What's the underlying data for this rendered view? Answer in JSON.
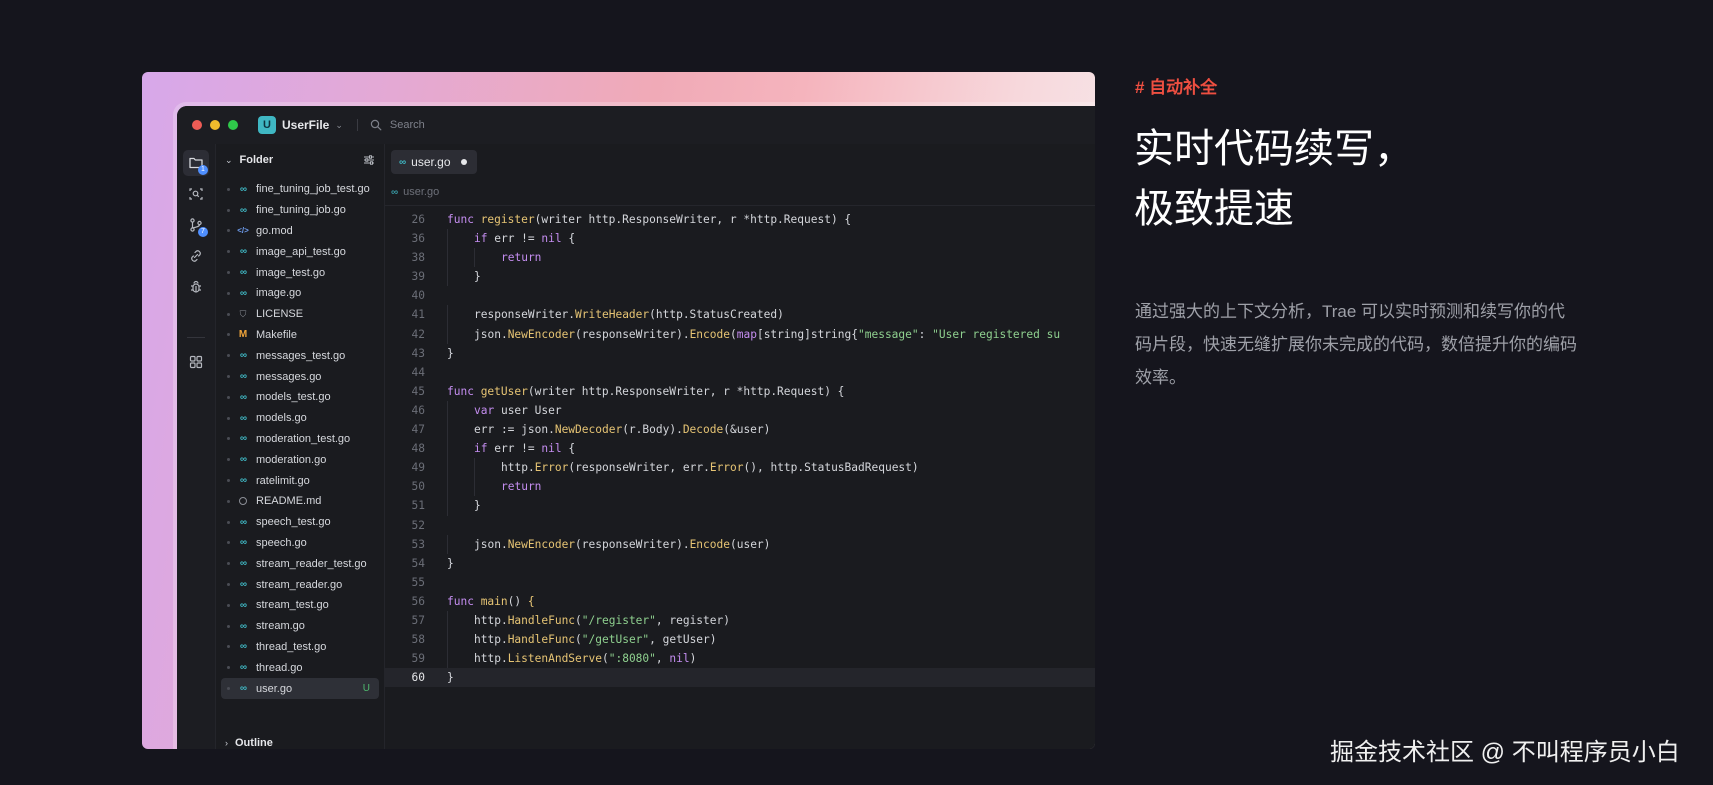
{
  "titlebar": {
    "project_badge": "U",
    "project_name": "UserFile",
    "search_placeholder": "Search"
  },
  "activity_bar": {
    "explorer_badge": "1",
    "scm_badge": "7"
  },
  "explorer": {
    "title": "Folder",
    "files": [
      {
        "name": "fine_tuning_job_test.go",
        "icon": "go-file-icon",
        "status": ""
      },
      {
        "name": "fine_tuning_job.go",
        "icon": "go-file-icon",
        "status": ""
      },
      {
        "name": "go.mod",
        "icon": "go-mod-icon",
        "status": ""
      },
      {
        "name": "image_api_test.go",
        "icon": "go-file-icon",
        "status": ""
      },
      {
        "name": "image_test.go",
        "icon": "go-file-icon",
        "status": ""
      },
      {
        "name": "image.go",
        "icon": "go-file-icon",
        "status": ""
      },
      {
        "name": "LICENSE",
        "icon": "license-icon",
        "status": ""
      },
      {
        "name": "Makefile",
        "icon": "makefile-icon",
        "status": ""
      },
      {
        "name": "messages_test.go",
        "icon": "go-file-icon",
        "status": ""
      },
      {
        "name": "messages.go",
        "icon": "go-file-icon",
        "status": ""
      },
      {
        "name": "models_test.go",
        "icon": "go-file-icon",
        "status": ""
      },
      {
        "name": "models.go",
        "icon": "go-file-icon",
        "status": ""
      },
      {
        "name": "moderation_test.go",
        "icon": "go-file-icon",
        "status": ""
      },
      {
        "name": "moderation.go",
        "icon": "go-file-icon",
        "status": ""
      },
      {
        "name": "ratelimit.go",
        "icon": "go-file-icon",
        "status": ""
      },
      {
        "name": "README.md",
        "icon": "readme-icon",
        "status": ""
      },
      {
        "name": "speech_test.go",
        "icon": "go-file-icon",
        "status": ""
      },
      {
        "name": "speech.go",
        "icon": "go-file-icon",
        "status": ""
      },
      {
        "name": "stream_reader_test.go",
        "icon": "go-file-icon",
        "status": ""
      },
      {
        "name": "stream_reader.go",
        "icon": "go-file-icon",
        "status": ""
      },
      {
        "name": "stream_test.go",
        "icon": "go-file-icon",
        "status": ""
      },
      {
        "name": "stream.go",
        "icon": "go-file-icon",
        "status": ""
      },
      {
        "name": "thread_test.go",
        "icon": "go-file-icon",
        "status": ""
      },
      {
        "name": "thread.go",
        "icon": "go-file-icon",
        "status": ""
      },
      {
        "name": "user.go",
        "icon": "go-file-icon",
        "status": "U",
        "selected": true
      }
    ],
    "outline_title": "Outline"
  },
  "editor": {
    "tab_label": "user.go",
    "breadcrumb": "user.go",
    "current_line": "60",
    "lines": [
      {
        "n": "26",
        "indent": 0,
        "t": [
          [
            "kw",
            "func "
          ],
          [
            "fn",
            "register"
          ],
          [
            "pn",
            "(writer http.ResponseWriter, r *http.Request) {"
          ]
        ]
      },
      {
        "n": "36",
        "indent": 1,
        "t": [
          [
            "kw",
            "if "
          ],
          [
            "pn",
            "err != "
          ],
          [
            "kw",
            "nil"
          ],
          [
            "pn",
            " {"
          ]
        ]
      },
      {
        "n": "38",
        "indent": 2,
        "t": [
          [
            "kw",
            "return"
          ]
        ]
      },
      {
        "n": "39",
        "indent": 1,
        "t": [
          [
            "pn",
            "}"
          ]
        ]
      },
      {
        "n": "40",
        "indent": 0,
        "t": []
      },
      {
        "n": "41",
        "indent": 1,
        "t": [
          [
            "pn",
            "responseWriter."
          ],
          [
            "fn",
            "WriteHeader"
          ],
          [
            "pn",
            "(http.StatusCreated)"
          ]
        ]
      },
      {
        "n": "42",
        "indent": 1,
        "t": [
          [
            "pn",
            "json."
          ],
          [
            "fn",
            "NewEncoder"
          ],
          [
            "pn",
            "(responseWriter)."
          ],
          [
            "fn",
            "Encode"
          ],
          [
            "pn",
            "("
          ],
          [
            "kw",
            "map"
          ],
          [
            "pn",
            "[string]string{"
          ],
          [
            "st",
            "\"message\""
          ],
          [
            "pn",
            ": "
          ],
          [
            "st",
            "\"User registered su"
          ]
        ]
      },
      {
        "n": "43",
        "indent": 0,
        "t": [
          [
            "pn",
            "}"
          ]
        ]
      },
      {
        "n": "44",
        "indent": 0,
        "t": []
      },
      {
        "n": "45",
        "indent": 0,
        "t": [
          [
            "kw",
            "func "
          ],
          [
            "fn",
            "getUser"
          ],
          [
            "pn",
            "(writer http.ResponseWriter, r *http.Request) {"
          ]
        ]
      },
      {
        "n": "46",
        "indent": 1,
        "t": [
          [
            "kw",
            "var "
          ],
          [
            "pn",
            "user User"
          ]
        ]
      },
      {
        "n": "47",
        "indent": 1,
        "t": [
          [
            "pn",
            "err := json."
          ],
          [
            "fn",
            "NewDecoder"
          ],
          [
            "pn",
            "(r.Body)."
          ],
          [
            "fn",
            "Decode"
          ],
          [
            "pn",
            "(&user)"
          ]
        ]
      },
      {
        "n": "48",
        "indent": 1,
        "t": [
          [
            "kw",
            "if "
          ],
          [
            "pn",
            "err != "
          ],
          [
            "kw",
            "nil"
          ],
          [
            "pn",
            " {"
          ]
        ]
      },
      {
        "n": "49",
        "indent": 2,
        "t": [
          [
            "pn",
            "http."
          ],
          [
            "fn",
            "Error"
          ],
          [
            "pn",
            "(responseWriter, err."
          ],
          [
            "fn",
            "Error"
          ],
          [
            "pn",
            "(), http.StatusBadRequest)"
          ]
        ]
      },
      {
        "n": "50",
        "indent": 2,
        "t": [
          [
            "kw",
            "return"
          ]
        ]
      },
      {
        "n": "51",
        "indent": 1,
        "t": [
          [
            "pn",
            "}"
          ]
        ]
      },
      {
        "n": "52",
        "indent": 0,
        "t": []
      },
      {
        "n": "53",
        "indent": 1,
        "t": [
          [
            "pn",
            "json."
          ],
          [
            "fn",
            "NewEncoder"
          ],
          [
            "pn",
            "(responseWriter)."
          ],
          [
            "fn",
            "Encode"
          ],
          [
            "pn",
            "(user)"
          ]
        ]
      },
      {
        "n": "54",
        "indent": 0,
        "t": [
          [
            "pn",
            "}"
          ]
        ]
      },
      {
        "n": "55",
        "indent": 0,
        "t": []
      },
      {
        "n": "56",
        "indent": 0,
        "t": [
          [
            "kw",
            "func "
          ],
          [
            "fn",
            "main"
          ],
          [
            "pn",
            "() "
          ],
          [
            "fn",
            "{"
          ]
        ]
      },
      {
        "n": "57",
        "indent": 1,
        "t": [
          [
            "pn",
            "http."
          ],
          [
            "fn",
            "HandleFunc"
          ],
          [
            "pn",
            "("
          ],
          [
            "st",
            "\"/register\""
          ],
          [
            "pn",
            ", register)"
          ]
        ]
      },
      {
        "n": "58",
        "indent": 1,
        "t": [
          [
            "pn",
            "http."
          ],
          [
            "fn",
            "HandleFunc"
          ],
          [
            "pn",
            "("
          ],
          [
            "st",
            "\"/getUser\""
          ],
          [
            "pn",
            ", getUser)"
          ]
        ]
      },
      {
        "n": "59",
        "indent": 1,
        "t": [
          [
            "pn",
            "http."
          ],
          [
            "fn",
            "ListenAndServe"
          ],
          [
            "pn",
            "("
          ],
          [
            "st",
            "\":8080\""
          ],
          [
            "pn",
            ", "
          ],
          [
            "kw",
            "nil"
          ],
          [
            "pn",
            ")"
          ]
        ]
      },
      {
        "n": "60",
        "indent": 0,
        "t": [
          [
            "pn",
            "}"
          ]
        ]
      }
    ]
  },
  "feature": {
    "tag": "# 自动补全",
    "headline_line1": "实时代码续写，",
    "headline_line2": "极致提速",
    "description": "通过强大的上下文分析，Trae 可以实时预测和续写你的代码片段，快速无缝扩展你未完成的代码，数倍提升你的编码效率。"
  },
  "watermark": "掘金技术社区 @ 不叫程序员小白",
  "colors": {
    "page_bg": "#15151d",
    "ide_bg": "#1a1b1f",
    "accent_tag": "#ee4f41",
    "keyword": "#c48df0",
    "function": "#e6c474",
    "string": "#8fd08f",
    "go_icon": "#3fb7c3"
  }
}
